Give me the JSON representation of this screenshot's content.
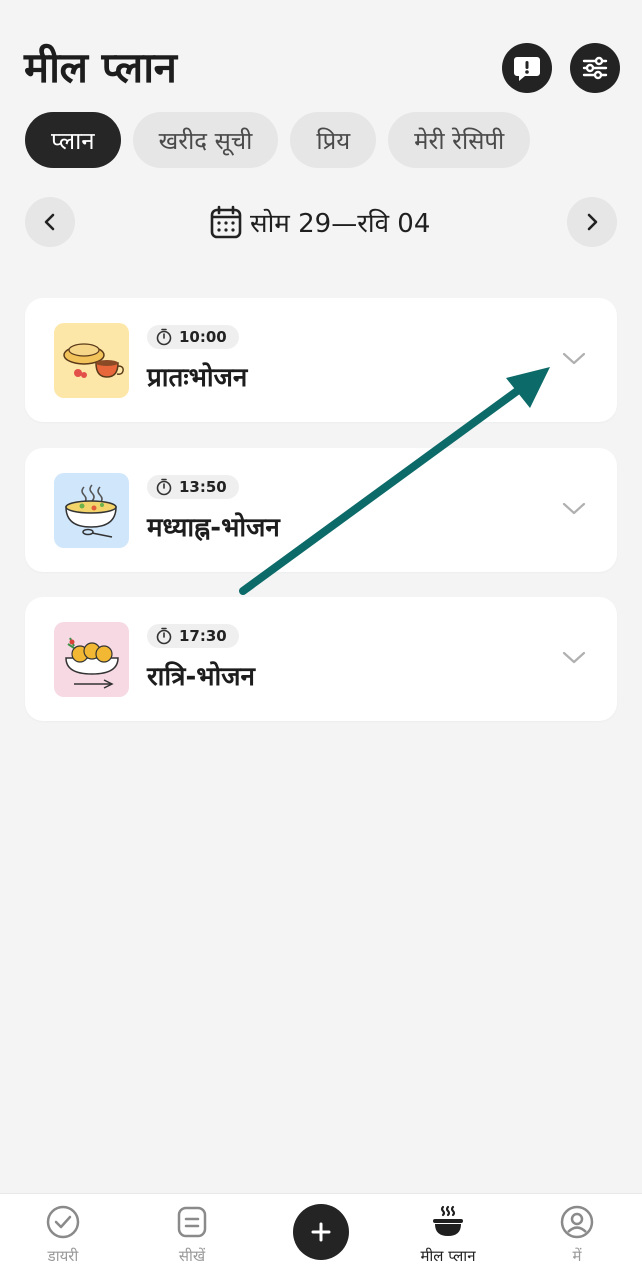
{
  "header": {
    "title": "मील प्लान",
    "feedback_icon": "feedback-alert-icon",
    "filter_icon": "filter-sliders-icon"
  },
  "tabs": [
    {
      "label": "प्लान",
      "active": true
    },
    {
      "label": "खरीद सूची",
      "active": false
    },
    {
      "label": "प्रिय",
      "active": false
    },
    {
      "label": "मेरी रेसिपी",
      "active": false
    }
  ],
  "week": {
    "range": "सोम 29—रवि 04"
  },
  "meals": [
    {
      "time": "10:00",
      "name": "प्रातःभोजन",
      "thumb_bg": "#fde7a8"
    },
    {
      "time": "13:50",
      "name": "मध्याह्न-भोजन",
      "thumb_bg": "#cfe6fb"
    },
    {
      "time": "17:30",
      "name": "रात्रि-भोजन",
      "thumb_bg": "#f6d9e3"
    }
  ],
  "bottom_nav": [
    {
      "label": "डायरी",
      "icon": "check-circle-icon",
      "active": false
    },
    {
      "label": "सीखें",
      "icon": "note-icon",
      "active": false
    },
    {
      "label": "मील प्लान",
      "icon": "bowl-steam-icon",
      "active": true
    },
    {
      "label": "में",
      "icon": "profile-icon",
      "active": false
    }
  ],
  "colors": {
    "background": "#f4f4f4",
    "dark": "#242424",
    "annotation_arrow": "#0c6b69"
  }
}
